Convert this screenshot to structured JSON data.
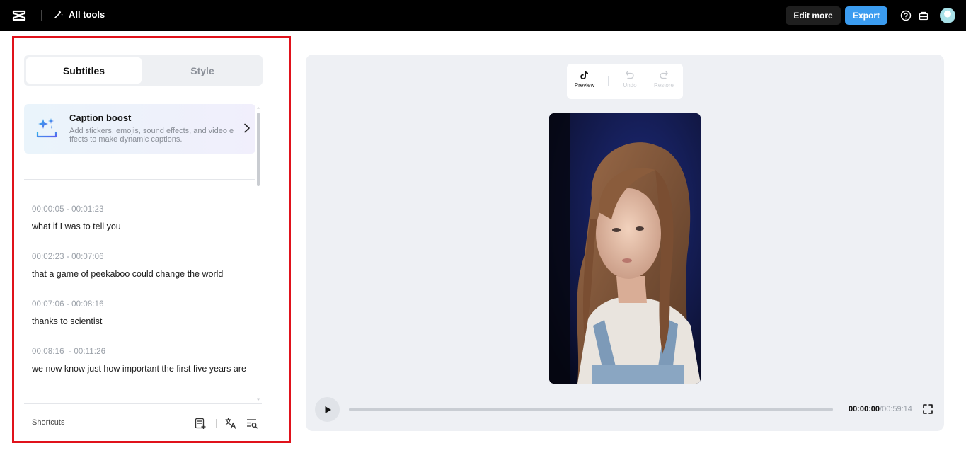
{
  "topbar": {
    "all_tools_label": "All tools",
    "edit_more_label": "Edit more",
    "export_label": "Export",
    "icons": [
      "capcut-logo-icon",
      "magic-wand-icon",
      "help-icon",
      "layers-icon",
      "avatar"
    ]
  },
  "panel": {
    "tabs": [
      {
        "label": "Subtitles",
        "active": true
      },
      {
        "label": "Style",
        "active": false
      }
    ],
    "caption_boost": {
      "title": "Caption boost",
      "description": "Add stickers, emojis, sound effects, and video effects to make dynamic captions."
    },
    "subtitles": [
      {
        "time": "00:00:05 - 00:01:23",
        "text": "what if I was to tell you"
      },
      {
        "time": "00:02:23 - 00:07:06",
        "text": "that a game of peekaboo could change the world"
      },
      {
        "time": "00:07:06 - 00:08:16",
        "text": "thanks to scientist"
      },
      {
        "time": "00:08:16  - 00:11:26",
        "text": "we now know just how important the first five years are"
      }
    ],
    "footer": {
      "shortcuts_label": "Shortcuts",
      "icons": [
        "add-subtitle-icon",
        "translate-icon",
        "search-subtitles-icon"
      ]
    }
  },
  "preview": {
    "tools": [
      {
        "label": "Preview",
        "icon": "tiktok-icon",
        "enabled": true
      },
      {
        "label": "Undo",
        "icon": "undo-icon",
        "enabled": false
      },
      {
        "label": "Restore",
        "icon": "redo-icon",
        "enabled": false
      }
    ],
    "player": {
      "current_time": "00:00:00",
      "total_time": "/00:59:14",
      "progress_fraction": 0
    }
  },
  "colors": {
    "highlight_border": "#e0121b",
    "export_button": "#3b9cf0",
    "topbar": "#000000"
  }
}
